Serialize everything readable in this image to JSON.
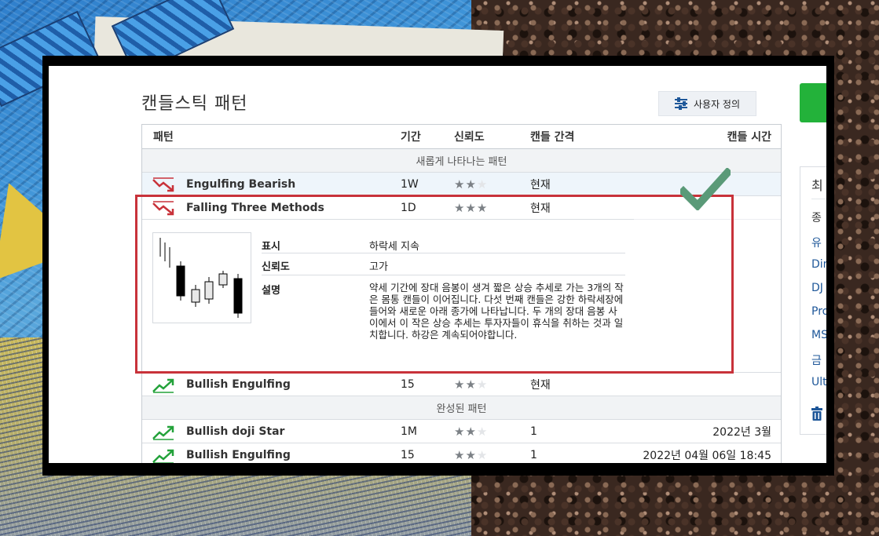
{
  "page": {
    "title": "캔들스틱 패턴"
  },
  "toolbar": {
    "custom_label": "사용자 정의"
  },
  "table": {
    "headers": {
      "pattern": "패턴",
      "period": "기간",
      "reliability": "신뢰도",
      "interval": "캔들 간격",
      "time": "캔들 시간"
    },
    "sections": {
      "emerging": "새롭게 나타나는 패턴",
      "completed": "완성된 패턴"
    },
    "rows": [
      {
        "name": "Engulfing Bearish",
        "period": "1W",
        "stars": 2,
        "interval": "현재",
        "time": "",
        "direction": "bearish"
      },
      {
        "name": "Falling Three Methods",
        "period": "1D",
        "stars": 3,
        "interval": "현재",
        "time": "",
        "direction": "bearish"
      },
      {
        "name": "Bullish Engulfing",
        "period": "15",
        "stars": 2,
        "interval": "현재",
        "time": "",
        "direction": "bullish"
      },
      {
        "name": "Bullish doji Star",
        "period": "1M",
        "stars": 2,
        "interval": "1",
        "time": "2022년 3월",
        "direction": "bullish"
      },
      {
        "name": "Bullish Engulfing",
        "period": "15",
        "stars": 2,
        "interval": "1",
        "time": "2022년 04월 06일 18:45",
        "direction": "bullish"
      }
    ],
    "star_char": "★"
  },
  "detail": {
    "labels": {
      "display": "표시",
      "reliability": "신뢰도",
      "description": "설명"
    },
    "display": "하락세 지속",
    "reliability": "고가",
    "description": "약세 기간에 장대 음봉이 생겨 짧은 상승 추세로 가는 3개의 작은 몸통 캔들이 이어집니다. 다섯 번째 캔들은 강한 하락세장에 들어와 새로운 아래 종가에 나타납니다. 두 개의 장대 음봉 사이에서 이 작은 상승 추세는 투자자들이 휴식을 취하는 것과 일치합니다. 하강은 계속되어야합니다."
  },
  "sidebar": {
    "title": "최",
    "links": [
      "종",
      "유",
      "Din",
      "DJ",
      "Pro",
      "MS",
      "금",
      "Ult"
    ]
  },
  "colors": {
    "bearish": "#c8323a",
    "bullish": "#23a23a",
    "accent": "#1e5799",
    "annotation": "#c8323a",
    "check": "#5a9a78"
  }
}
